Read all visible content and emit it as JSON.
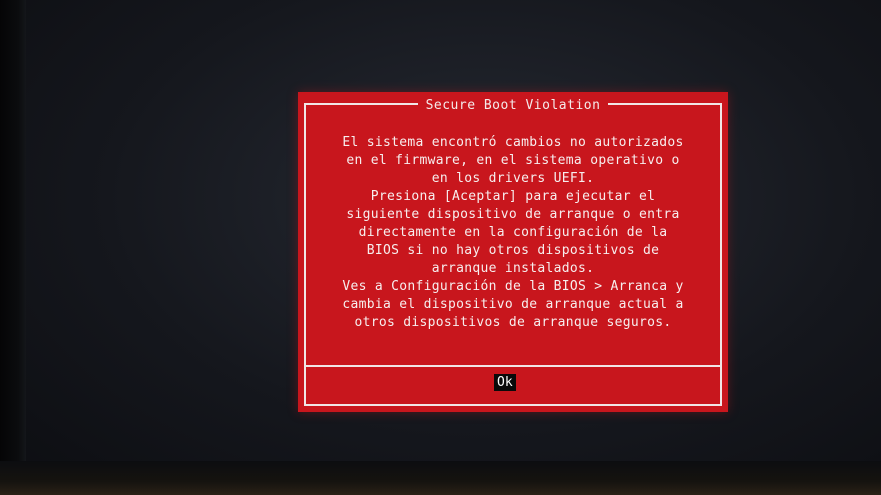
{
  "dialog": {
    "title": "Secure Boot Violation",
    "message_lines": [
      "El sistema encontró cambios no autorizados",
      "en el firmware, en el sistema operativo o",
      "en los drivers UEFI.",
      "Presiona [Aceptar] para ejecutar el",
      "siguiente dispositivo de arranque o entra",
      "directamente en la configuración de la",
      "BIOS si no hay otros dispositivos de",
      "arranque instalados.",
      "Ves a Configuración de la BIOS > Arranca y",
      "cambia el dispositivo de arranque actual a",
      "otros dispositivos de arranque seguros."
    ],
    "ok_label": "Ok",
    "background_color": "#c8161d"
  }
}
